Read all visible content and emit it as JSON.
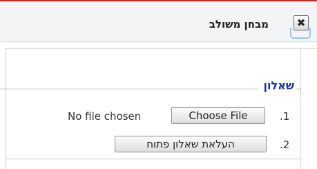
{
  "dialog": {
    "title": "מבחן משולב",
    "close_symbol": "✖"
  },
  "section": {
    "legend": "שאלון",
    "items": [
      {
        "number": ".1",
        "status": "No file chosen",
        "button_label": "Choose File"
      },
      {
        "number": ".2",
        "button_label": "העלאת שאלון פתוח"
      }
    ]
  }
}
